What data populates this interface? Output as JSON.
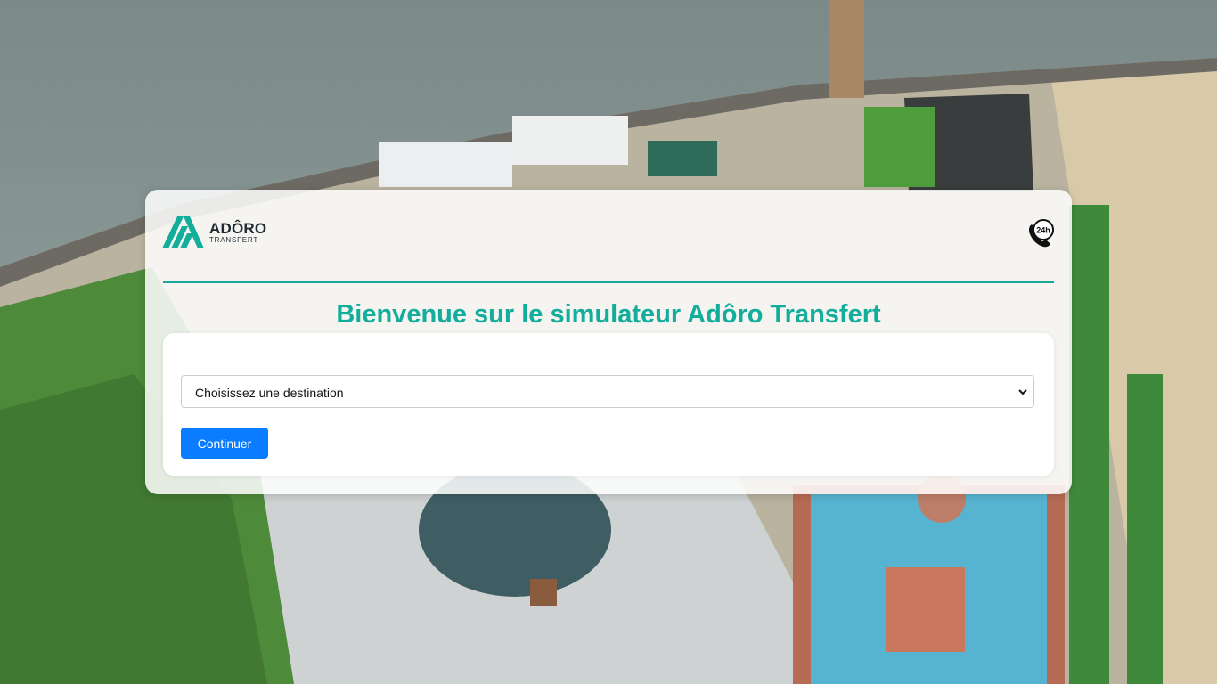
{
  "brand": {
    "name": "ADÔRO",
    "subtitle": "Transfert",
    "accent_color": "#13ad9b",
    "logo_icon": "adoro-logo-icon",
    "logo_text": "ADÔRO TRANSFERT"
  },
  "header": {
    "support_icon": "phone-24h-icon",
    "support_label": "24h"
  },
  "main": {
    "title": "Bienvenue sur le simulateur Adôro Transfert",
    "destination_select": {
      "selected": "Choisissez une destination"
    },
    "continue_label": "Continuer"
  },
  "colors": {
    "button": "#0a7cff",
    "divider": "#1aa89a"
  }
}
